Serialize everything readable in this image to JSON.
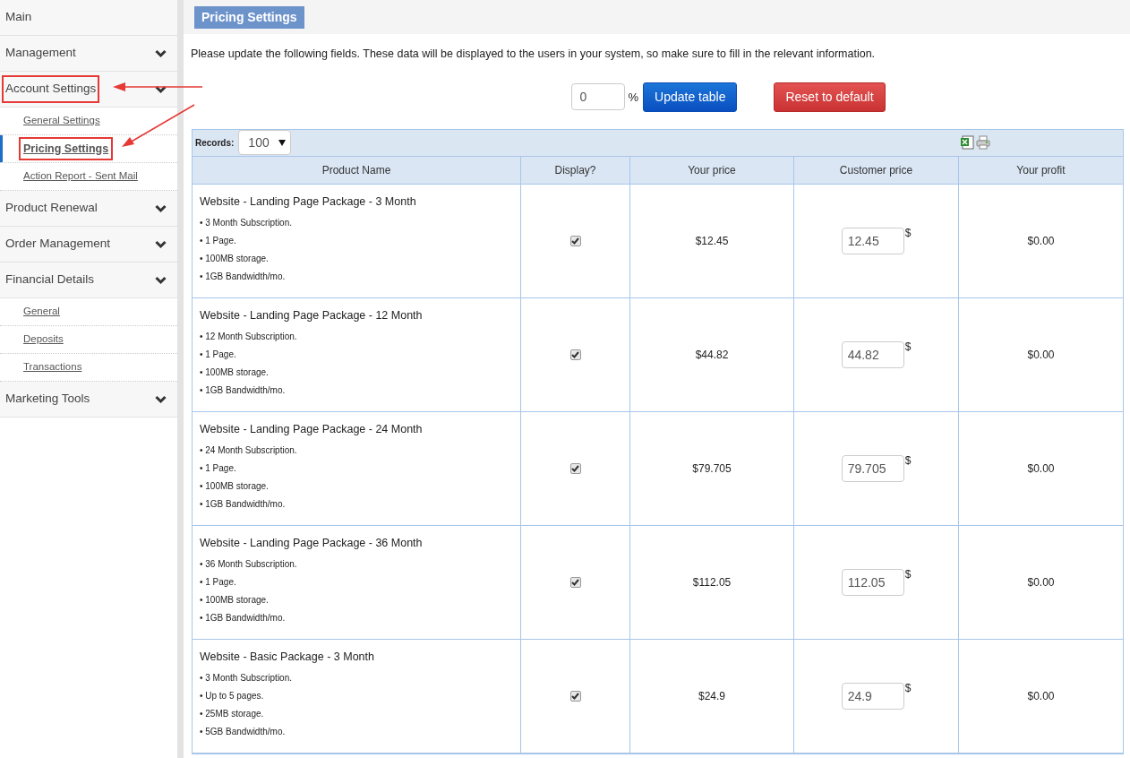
{
  "sidebar": {
    "items": [
      {
        "label": "Main",
        "expandable": false,
        "highlighted": false
      },
      {
        "label": "Management",
        "expandable": true,
        "highlighted": false
      },
      {
        "label": "Account Settings",
        "expandable": true,
        "highlighted": true,
        "children": [
          {
            "label": "General Settings",
            "selected": false,
            "highlighted": false
          },
          {
            "label": "Pricing Settings",
            "selected": true,
            "highlighted": true
          },
          {
            "label": "Action Report - Sent Mail",
            "selected": false,
            "highlighted": false
          }
        ]
      },
      {
        "label": "Product Renewal",
        "expandable": true,
        "highlighted": false
      },
      {
        "label": "Order Management",
        "expandable": true,
        "highlighted": false
      },
      {
        "label": "Financial Details",
        "expandable": true,
        "highlighted": false,
        "children": [
          {
            "label": "General",
            "selected": false,
            "highlighted": false
          },
          {
            "label": "Deposits",
            "selected": false,
            "highlighted": false
          },
          {
            "label": "Transactions",
            "selected": false,
            "highlighted": false
          }
        ]
      },
      {
        "label": "Marketing Tools",
        "expandable": true,
        "highlighted": false
      }
    ]
  },
  "page_title": "Pricing Settings",
  "description": "Please update the following fields. These data will be displayed to the users in your system, so make sure to fill in the relevant information.",
  "adjust": {
    "value": "0",
    "unit": "%",
    "update_button": "Update table",
    "reset_button": "Reset to default"
  },
  "table": {
    "records_label": "Records:",
    "records_value": "100",
    "columns": [
      "Product Name",
      "Display?",
      "Your price",
      "Customer price",
      "Your profit"
    ],
    "rows": [
      {
        "name": "Website - Landing Page Package - 3 Month",
        "features": [
          "• 3 Month Subscription.",
          "• 1 Page.",
          "• 100MB storage.",
          "• 1GB Bandwidth/mo."
        ],
        "display": true,
        "your_price": "$12.45",
        "customer_price": "12.45",
        "currency": "$",
        "profit": "$0.00"
      },
      {
        "name": "Website - Landing Page Package - 12 Month",
        "features": [
          "• 12 Month Subscription.",
          "• 1 Page.",
          "• 100MB storage.",
          "• 1GB Bandwidth/mo."
        ],
        "display": true,
        "your_price": "$44.82",
        "customer_price": "44.82",
        "currency": "$",
        "profit": "$0.00"
      },
      {
        "name": "Website - Landing Page Package - 24 Month",
        "features": [
          "• 24 Month Subscription.",
          "• 1 Page.",
          "• 100MB storage.",
          "• 1GB Bandwidth/mo."
        ],
        "display": true,
        "your_price": "$79.705",
        "customer_price": "79.705",
        "currency": "$",
        "profit": "$0.00"
      },
      {
        "name": "Website - Landing Page Package - 36 Month",
        "features": [
          "• 36 Month Subscription.",
          "• 1 Page.",
          "• 100MB storage.",
          "• 1GB Bandwidth/mo."
        ],
        "display": true,
        "your_price": "$112.05",
        "customer_price": "112.05",
        "currency": "$",
        "profit": "$0.00"
      },
      {
        "name": "Website - Basic Package - 3 Month",
        "features": [
          "• 3 Month Subscription.",
          "• Up to 5 pages.",
          "• 25MB storage.",
          "• 5GB Bandwidth/mo."
        ],
        "display": true,
        "your_price": "$24.9",
        "customer_price": "24.9",
        "currency": "$",
        "profit": "$0.00"
      }
    ]
  }
}
